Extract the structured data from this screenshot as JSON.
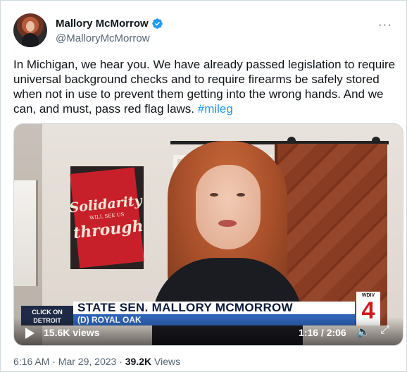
{
  "author": {
    "name": "Mallory McMorrow",
    "handle": "@MalloryMcMorrow"
  },
  "more_icon": "···",
  "tweet": {
    "text": "In Michigan, we hear you. We have already passed legislation to require universal background checks and to require firearms be safely stored when not in use to prevent them getting into the wrong hands. And we can, and must, pass red flag laws. ",
    "hashtag": "#mileg"
  },
  "video": {
    "poster": {
      "line1": "Solidarity",
      "line2": "WILL SEE US",
      "line3": "through"
    },
    "lower_third": {
      "logo": "CLICK ON DETROIT",
      "title": "STATE SEN. MALLORY MCMORROW",
      "subtitle": "(D) ROYAL OAK",
      "station_call": "WDIV",
      "station_num": "4"
    },
    "views": "15.6K views",
    "time": "1:16 / 2:06",
    "progress_fraction": 0.603
  },
  "meta": {
    "time": "6:16 AM · Mar 29, 2023 · ",
    "views_count": "39.2K",
    "views_label": " Views"
  },
  "colors": {
    "link": "#1d9bf0",
    "verified": "#1d9bf0",
    "secondary_text": "#536471"
  }
}
